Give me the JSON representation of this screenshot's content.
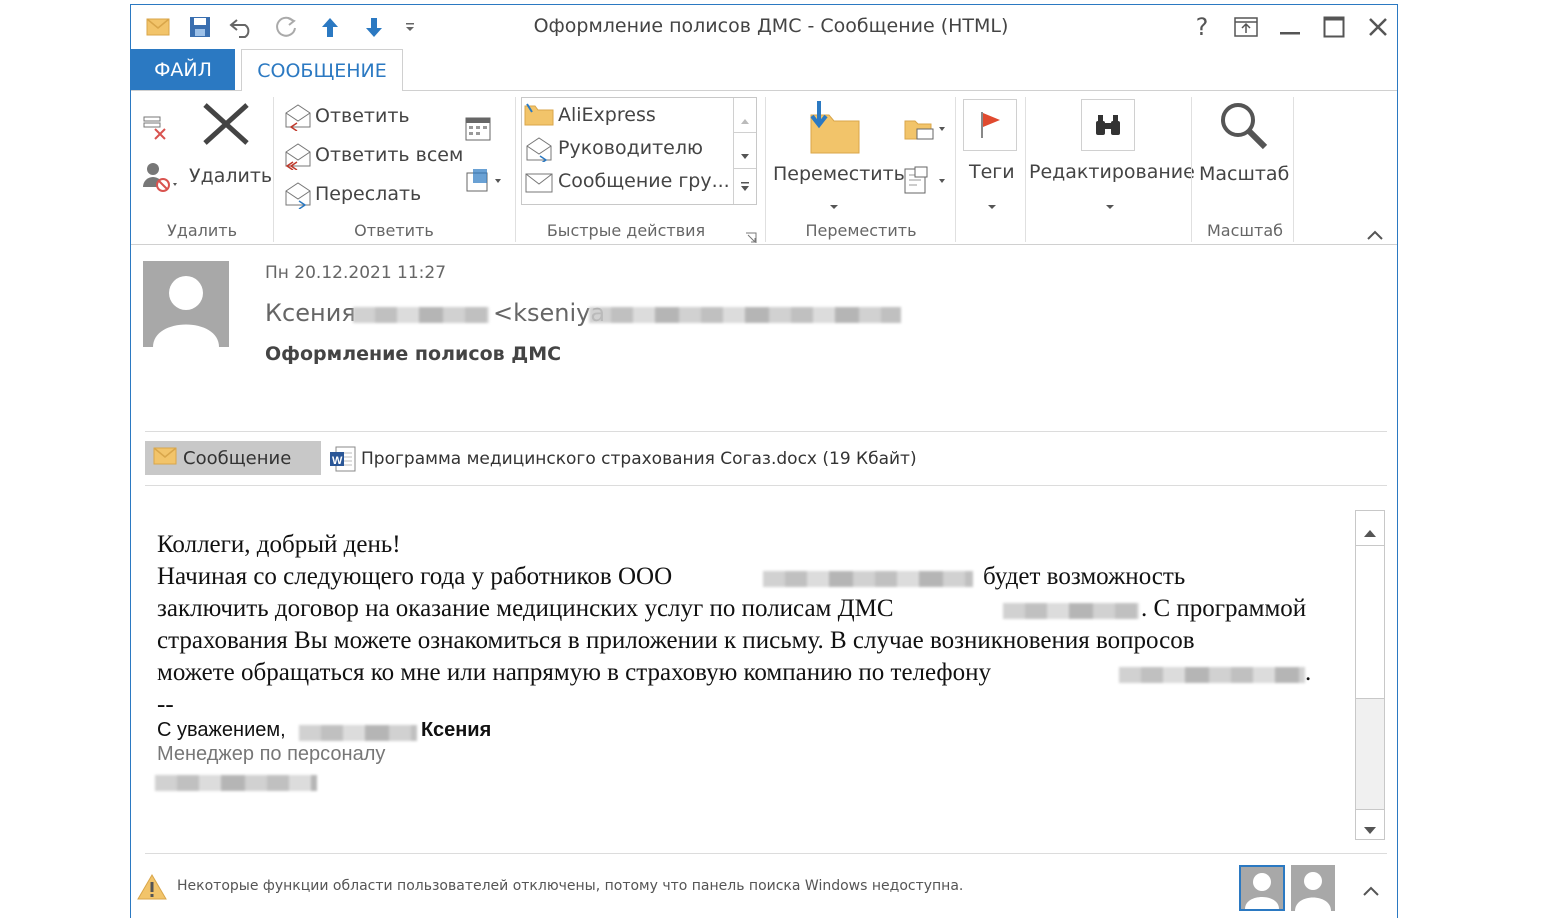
{
  "window": {
    "title": "Оформление полисов ДМС - Сообщение (HTML)",
    "help_label": "?"
  },
  "tabs": {
    "file_label": "ФАЙЛ",
    "message_label": "СООБЩЕНИЕ"
  },
  "ribbon": {
    "delete_group": {
      "delete_label": "Удалить",
      "group_label": "Удалить"
    },
    "respond_group": {
      "reply_label": "Ответить",
      "reply_all_label": "Ответить всем",
      "forward_label": "Переслать",
      "group_label": "Ответить"
    },
    "quick_steps_group": {
      "items": [
        "AliExpress",
        "Руководителю",
        "Сообщение гру..."
      ],
      "group_label": "Быстрые действия"
    },
    "move_group": {
      "move_label": "Переместить",
      "group_label": "Переместить"
    },
    "tags_label": "Теги",
    "editing_label": "Редактирование",
    "zoom_group": {
      "zoom_label": "Масштаб",
      "group_label": "Масштаб"
    }
  },
  "header": {
    "date": "Пн 20.12.2021 11:27",
    "sender_first_name": "Ксения",
    "sender_email_prefix": "<kseniya",
    "subject": "Оформление полисов ДМС"
  },
  "attachments": {
    "message_tab_label": "Сообщение",
    "file_label": "Программа медицинского страхования Согаз.docx (19 Кбайт)"
  },
  "body": {
    "greeting": "Коллеги, добрый день!",
    "line1_a": "Начиная со следующего года у работников ООО",
    "line1_b": "будет возможность",
    "line2_a": "заключить договор на оказание медицинских услуг по полисам ДМС",
    "line2_b": ". С программой",
    "line3": "страхования Вы можете ознакомиться в приложении к письму. В случае возникновения вопросов",
    "line4": "можете обращаться ко мне или напрямую в страховую компанию по телефону",
    "line4_end": ".",
    "sig_dash": "--",
    "sig_regards": "С уважением,",
    "sig_name": "Ксения",
    "sig_title": "Менеджер по персоналу"
  },
  "status": {
    "warning_text": "Некоторые функции области пользователей отключены, потому что панель поиска Windows недоступна."
  },
  "colors": {
    "accent": "#2b79c2",
    "flag": "#e04a2f",
    "folder": "#f2c46a"
  }
}
